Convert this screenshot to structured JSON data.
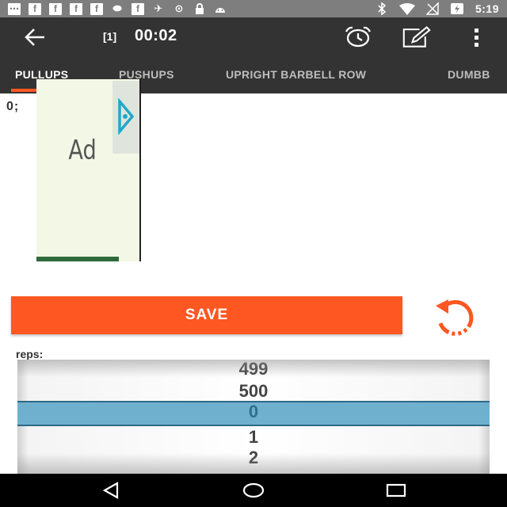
{
  "status_bar": {
    "left_icons": [
      "message-icon",
      "facebook-icon",
      "facebook-icon",
      "facebook-icon",
      "facebook-icon",
      "chat-bubble-icon",
      "facebook-icon",
      "satellite-icon",
      "sync-icon",
      "lock-icon",
      "android-icon"
    ],
    "right_icons": [
      "bluetooth-icon",
      "wifi-icon",
      "no-signal-icon",
      "battery-charging-icon"
    ],
    "time": "5:19"
  },
  "toolbar": {
    "set_index": "[1]",
    "timer": "00:02",
    "icons": [
      "back-arrow-icon",
      "alarm-clock-icon",
      "edit-icon",
      "overflow-menu-icon"
    ]
  },
  "tabs": [
    {
      "label": "PULLUPS",
      "active": true
    },
    {
      "label": "PUSHUPS",
      "active": false
    },
    {
      "label": "UPRIGHT BARBELL ROW",
      "active": false
    },
    {
      "label": "DUMBB",
      "active": false
    }
  ],
  "record": "0;",
  "ad": {
    "label": "Ad"
  },
  "save_button": "SAVE",
  "reps_label": "reps:",
  "picker": {
    "values": [
      "499",
      "500",
      "0",
      "1",
      "2"
    ],
    "selected": "0"
  },
  "colors": {
    "accent": "#ff5722",
    "toolbar": "#333333",
    "status_bar": "#7e7e7e",
    "picker_selected": "#6fb0cf"
  }
}
